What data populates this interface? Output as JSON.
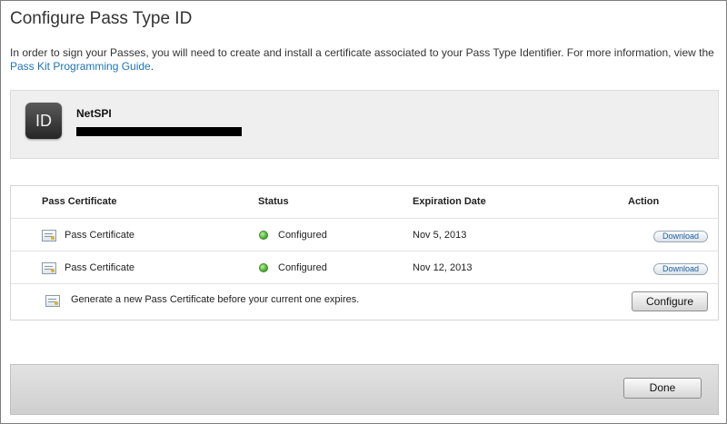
{
  "window": {
    "title": "Configure Pass Type ID"
  },
  "intro": {
    "text": "In order to sign your Passes, you will need to create and install a certificate associated to your Pass Type Identifier. For more information, view the ",
    "link_text": "Pass Kit Programming Guide",
    "suffix": "."
  },
  "identity": {
    "icon_text": "ID",
    "name": "NetSPI"
  },
  "table": {
    "columns": [
      "Pass Certificate",
      "Status",
      "Expiration Date",
      "Action"
    ],
    "rows": [
      {
        "name": "Pass Certificate",
        "status": "Configured",
        "expiration": "Nov 5, 2013",
        "action": "Download"
      },
      {
        "name": "Pass Certificate",
        "status": "Configured",
        "expiration": "Nov 12, 2013",
        "action": "Download"
      }
    ],
    "generate_text": "Generate a new Pass Certificate before your current one expires.",
    "configure_label": "Configure"
  },
  "footer": {
    "done_label": "Done"
  },
  "colors": {
    "link": "#1d74b8",
    "status_ok": "#3ea62a"
  },
  "icons": {
    "certificate": "certificate-icon",
    "status": "status-dot-icon",
    "identity": "id-badge-icon"
  }
}
